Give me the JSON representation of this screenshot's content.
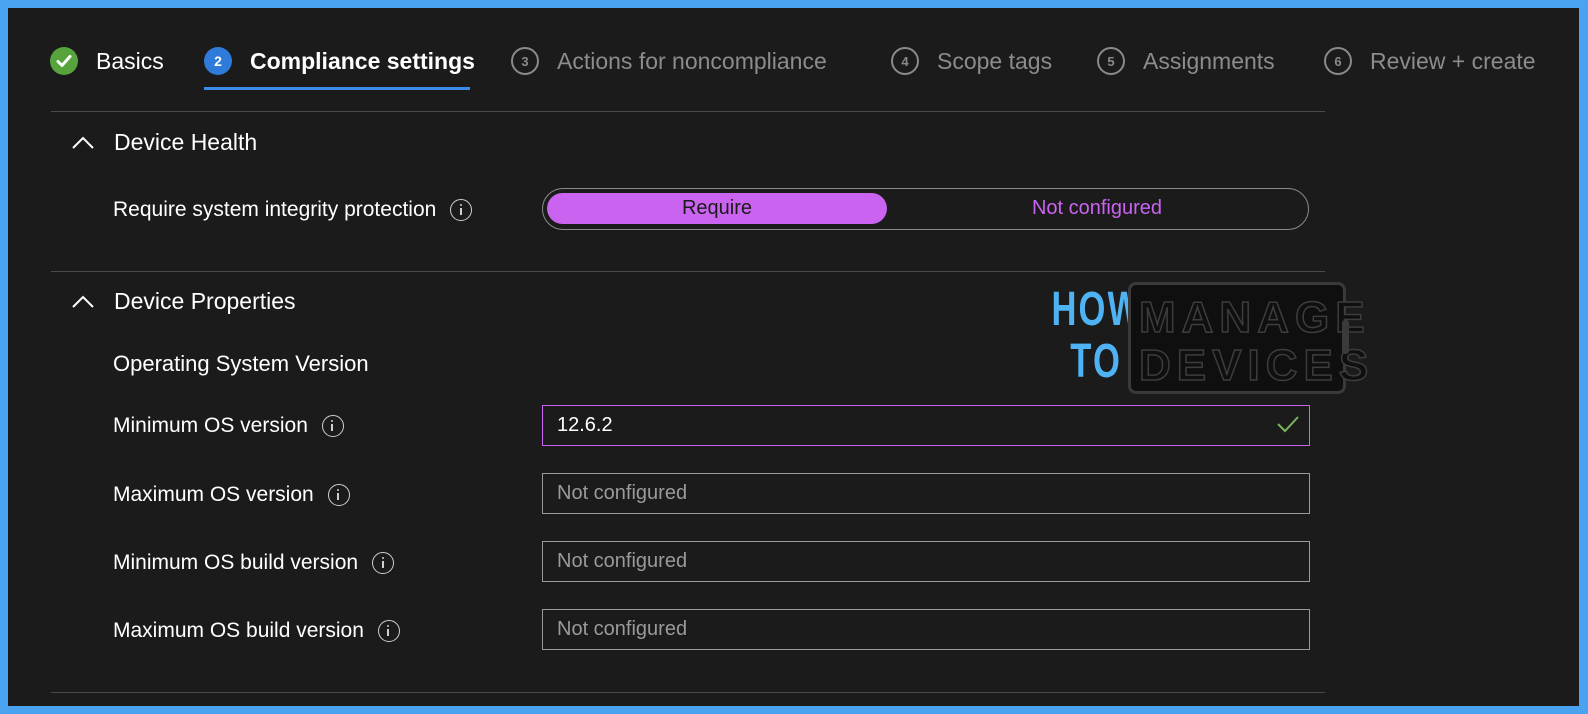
{
  "wizard": {
    "steps": [
      {
        "number": "",
        "label": "Basics",
        "state": "completed",
        "icon": "check-circle-icon"
      },
      {
        "number": "2",
        "label": "Compliance settings",
        "state": "active"
      },
      {
        "number": "3",
        "label": "Actions for noncompliance",
        "state": "pending"
      },
      {
        "number": "4",
        "label": "Scope tags",
        "state": "pending"
      },
      {
        "number": "5",
        "label": "Assignments",
        "state": "pending"
      },
      {
        "number": "6",
        "label": "Review + create",
        "state": "pending"
      }
    ]
  },
  "device_health": {
    "title": "Device Health",
    "expanded": true,
    "sip_label": "Require system integrity protection",
    "sip_options": [
      "Require",
      "Not configured"
    ],
    "sip_selected": "Require"
  },
  "device_properties": {
    "title": "Device Properties",
    "expanded": true,
    "os_version_heading": "Operating System Version",
    "fields": [
      {
        "label": "Minimum OS version",
        "value": "12.6.2",
        "placeholder": "Not configured",
        "valid": true
      },
      {
        "label": "Maximum OS version",
        "value": "",
        "placeholder": "Not configured"
      },
      {
        "label": "Minimum OS build version",
        "value": "",
        "placeholder": "Not configured"
      },
      {
        "label": "Maximum OS build version",
        "value": "",
        "placeholder": "Not configured"
      }
    ]
  },
  "watermark": {
    "line1": "HOW",
    "line2": "TO",
    "line3": "MANAGE",
    "line4": "DEVICES"
  },
  "colors": {
    "page_border": "#4aa3f0",
    "background": "#1b1b1b",
    "accent_purple": "#c963f0",
    "active_step": "#2f7bd9",
    "success_green": "#57a33c",
    "logo_blue": "#4fb3f3"
  }
}
